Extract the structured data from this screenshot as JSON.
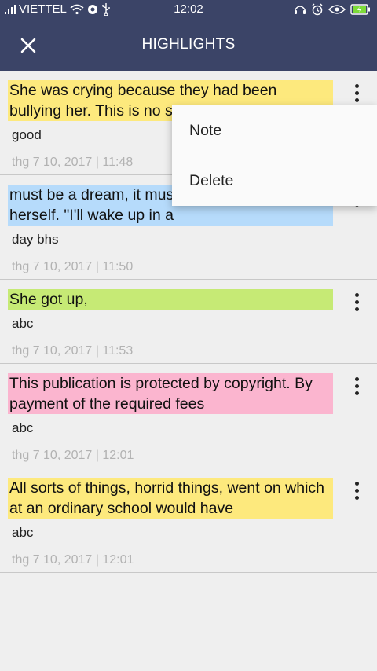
{
  "status_bar": {
    "carrier": "VIETTEL",
    "time": "12:02"
  },
  "header": {
    "title": "HIGHLIGHTS",
    "close_icon": "close-icon"
  },
  "colors": {
    "yellow": "#fde97d",
    "blue": "#b6dbfb",
    "green": "#c6ea75",
    "pink": "#fbb5cf",
    "header_bg": "#3b4467"
  },
  "highlights": [
    {
      "text": "She was crying because they had been bullying her. This is no school story, so I shall",
      "note": "good",
      "date": "thg 7 10, 2017 | 11:48",
      "color": "#fde97d"
    },
    {
      "text": "must be a dream, it must, it must,\" said Jill to herself. \"I'll wake up in a",
      "note": "day bhs",
      "date": "thg 7 10, 2017 | 11:50",
      "color": "#b6dbfb"
    },
    {
      "text": "She got up,",
      "note": "abc",
      "date": "thg 7 10, 2017 | 11:53",
      "color": "#c6ea75"
    },
    {
      "text": "This publication is protected by copyright. By payment of the required fees",
      "note": "abc",
      "date": "thg 7 10, 2017 | 12:01",
      "color": "#fbb5cf"
    },
    {
      "text": "All sorts of things, horrid things, went on which at an ordinary school would have",
      "note": "abc",
      "date": "thg 7 10, 2017 | 12:01",
      "color": "#fde97d"
    }
  ],
  "popup_menu": {
    "items": [
      "Note",
      "Delete"
    ]
  }
}
